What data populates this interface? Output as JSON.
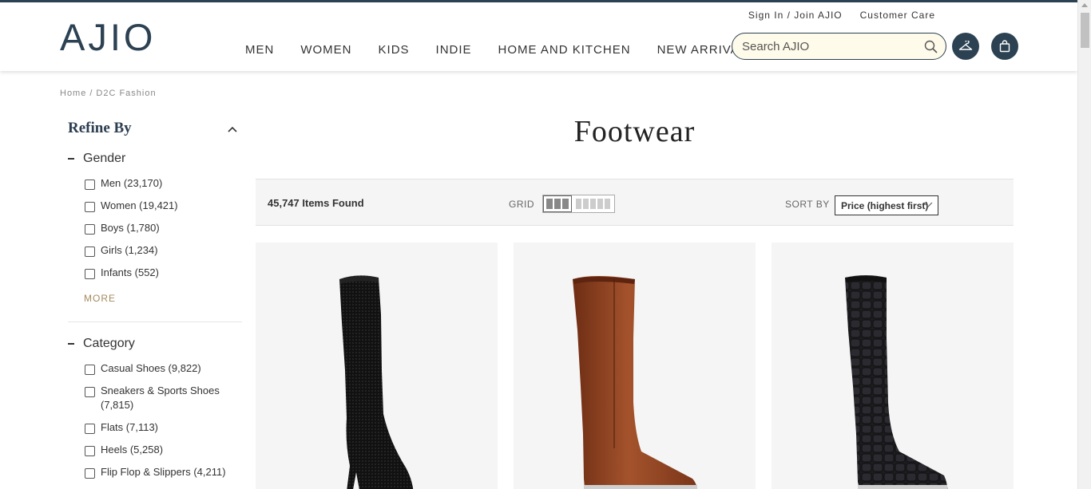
{
  "header": {
    "logo": "AJIO",
    "signin": "Sign In / Join AJIO",
    "customer_care": "Customer Care",
    "nav": [
      "MEN",
      "WOMEN",
      "KIDS",
      "INDIE",
      "HOME AND KITCHEN",
      "NEW ARRIVALS"
    ],
    "search_placeholder": "Search AJIO",
    "icons": {
      "search": "search-icon",
      "wishlist": "hanger-icon",
      "bag": "shopping-bag-icon"
    },
    "brand_color": "#2c4152"
  },
  "breadcrumb": {
    "home": "Home",
    "sep": "/",
    "current": "D2C Fashion"
  },
  "filters": {
    "title": "Refine By",
    "gender": {
      "heading": "Gender",
      "options": [
        "Men (23,170)",
        "Women (19,421)",
        "Boys (1,780)",
        "Girls (1,234)",
        "Infants (552)"
      ],
      "more": "MORE"
    },
    "category": {
      "heading": "Category",
      "options": [
        "Casual Shoes (9,822)",
        "Sneakers & Sports Shoes",
        "(7,815)",
        "Flats (7,113)",
        "Heels (5,258)",
        "Flip Flop & Slippers (4,211)"
      ]
    }
  },
  "main": {
    "title": "Footwear",
    "items_found": "45,747 Items Found",
    "grid_label": "GRID",
    "sort_label": "SORT BY",
    "sort_value": "Price (highest first)"
  },
  "products": [
    {
      "name": "black-mesh-knee-high-heeled-boot",
      "color": "#1a1a1a"
    },
    {
      "name": "brown-leather-knee-high-boot",
      "color": "#8b3f1f"
    },
    {
      "name": "black-croc-knee-high-boot",
      "color": "#1c1c1f"
    }
  ]
}
